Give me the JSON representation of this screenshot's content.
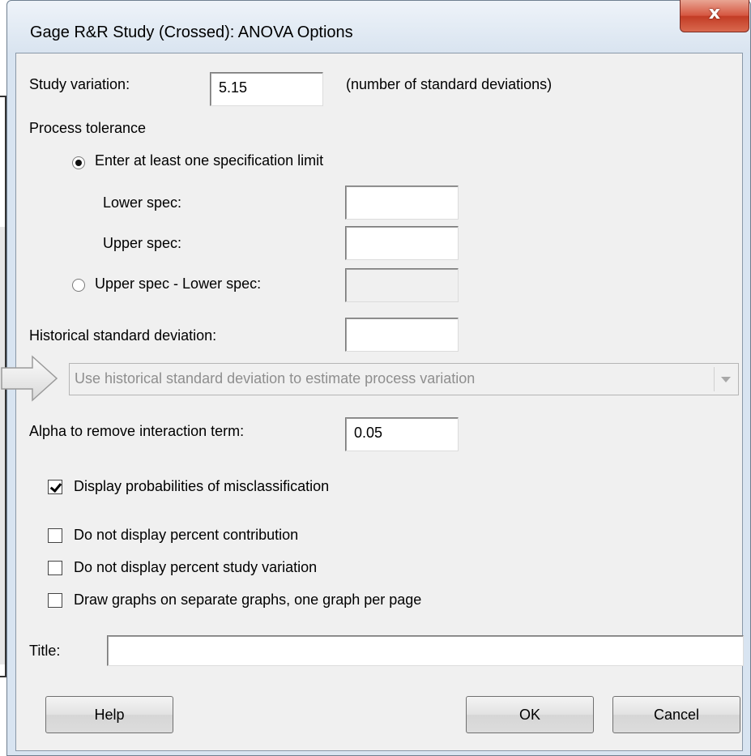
{
  "window": {
    "title": "Gage R&R Study (Crossed): ANOVA Options",
    "close_label": "x"
  },
  "study_variation": {
    "label": "Study variation:",
    "value": "5.15",
    "hint": "(number of standard deviations)"
  },
  "process_tolerance": {
    "heading": "Process tolerance",
    "option_spec_limit": "Enter at least one specification limit",
    "lower_spec_label": "Lower spec:",
    "lower_spec_value": "",
    "upper_spec_label": "Upper spec:",
    "upper_spec_value": "",
    "option_range": "Upper spec - Lower spec:",
    "range_value": "",
    "selected": "spec_limit"
  },
  "historical_sd": {
    "label": "Historical standard deviation:",
    "value": "",
    "dropdown_selected": "Use historical standard deviation to estimate process variation"
  },
  "alpha": {
    "label": "Alpha to remove interaction term:",
    "value": "0.05"
  },
  "checkboxes": {
    "misclassification": "Display probabilities of misclassification",
    "misclassification_checked": true,
    "no_percent_contribution": "Do not display percent contribution",
    "no_percent_contribution_checked": false,
    "no_percent_study_variation": "Do not display percent study variation",
    "no_percent_study_variation_checked": false,
    "separate_graphs": "Draw graphs on separate graphs, one graph per page",
    "separate_graphs_checked": false
  },
  "title_field": {
    "label": "Title:",
    "value": ""
  },
  "buttons": {
    "help": "Help",
    "ok": "OK",
    "cancel": "Cancel"
  }
}
